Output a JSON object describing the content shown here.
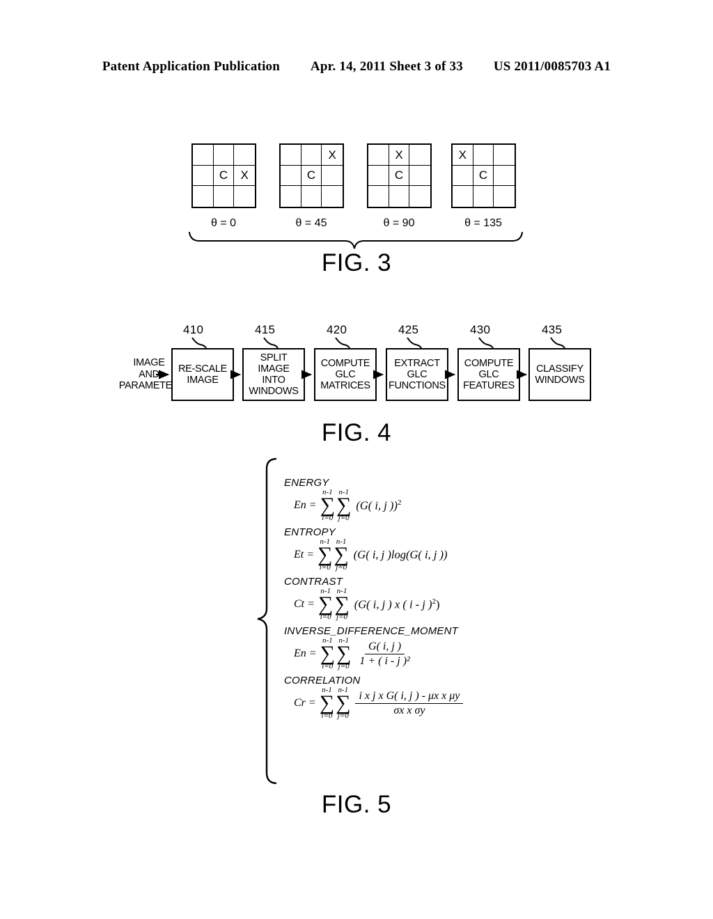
{
  "header": {
    "publication": "Patent Application Publication",
    "date_sheet": "Apr. 14, 2011  Sheet 3 of 33",
    "patent_number": "US 2011/0085703 A1"
  },
  "fig3": {
    "caption": "FIG. 3",
    "center_marker": "C",
    "neighbor_marker": "X",
    "grids": [
      {
        "theta_label": "θ = 0",
        "cells": [
          "",
          "",
          "",
          "",
          "C",
          "X",
          "",
          "",
          ""
        ]
      },
      {
        "theta_label": "θ = 45",
        "cells": [
          "",
          "",
          "X",
          "",
          "C",
          "",
          "",
          "",
          ""
        ]
      },
      {
        "theta_label": "θ = 90",
        "cells": [
          "",
          "X",
          "",
          "",
          "C",
          "",
          "",
          "",
          ""
        ]
      },
      {
        "theta_label": "θ = 135",
        "cells": [
          "X",
          "",
          "",
          "",
          "C",
          "",
          "",
          "",
          ""
        ]
      }
    ]
  },
  "fig4": {
    "caption": "FIG. 4",
    "input_label": "IMAGE\nAND\nPARAMETER",
    "steps": [
      {
        "ref": "410",
        "label": "RE-SCALE\nIMAGE"
      },
      {
        "ref": "415",
        "label": "SPLIT IMAGE\nINTO\nWINDOWS"
      },
      {
        "ref": "420",
        "label": "COMPUTE\nGLC\nMATRICES"
      },
      {
        "ref": "425",
        "label": "EXTRACT\nGLC\nFUNCTIONS"
      },
      {
        "ref": "430",
        "label": "COMPUTE\nGLC\nFEATURES"
      },
      {
        "ref": "435",
        "label": "CLASSIFY\nWINDOWS"
      }
    ]
  },
  "fig5": {
    "caption": "FIG. 5",
    "equations": [
      {
        "name": "ENERGY",
        "lhs": "En =",
        "upper_limit": "n-1",
        "lower_limit_i": "i=0",
        "lower_limit_j": "j=0",
        "body": "(G( i, j ))²",
        "body_base": "(G( i, j ))",
        "body_exp": "2"
      },
      {
        "name": "ENTROPY",
        "lhs": "Et =",
        "upper_limit": "n-1",
        "lower_limit_i": "i=0",
        "lower_limit_j": "j=0",
        "body": "(G( i, j )log(G( i, j ))",
        "body_base": "(G( i, j )log(G( i, j ))",
        "body_exp": ""
      },
      {
        "name": "CONTRAST",
        "lhs": "Ct =",
        "upper_limit": "n-1",
        "lower_limit_i": "i=0",
        "lower_limit_j": "j=0",
        "body": "(G( i, j ) x ( i - j )²)",
        "body_base": "(G( i, j ) x ( i - j )",
        "body_exp": "2"
      },
      {
        "name": "INVERSE_DIFFERENCE_MOMENT",
        "lhs": "En =",
        "upper_limit": "n-1",
        "lower_limit_i": "i=0",
        "lower_limit_j": "j=0",
        "numerator": "G( i, j )",
        "denominator": "1 + ( i - j )²"
      },
      {
        "name": "CORRELATION",
        "lhs": "Cr =",
        "upper_limit": "n-1",
        "lower_limit_i": "i=0",
        "lower_limit_j": "j=0",
        "numerator": "i x j x G( i, j ) - μx x μy",
        "denominator": "σx x σy"
      }
    ]
  },
  "sigma_glyph": "∑"
}
